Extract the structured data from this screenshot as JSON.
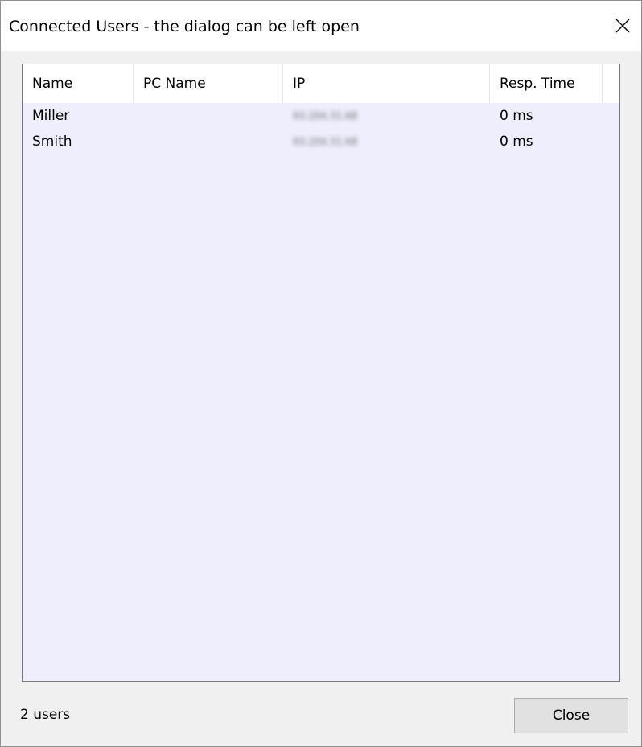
{
  "dialog": {
    "title": "Connected Users - the dialog can be left open",
    "close_icon": "close-icon"
  },
  "list": {
    "columns": [
      "Name",
      "PC Name",
      "IP",
      "Resp. Time"
    ],
    "rows": [
      {
        "name": "Miller",
        "pc_name": "",
        "ip": "93.204.31.68",
        "resp_time": "0 ms"
      },
      {
        "name": "Smith",
        "pc_name": "",
        "ip": "93.204.31.68",
        "resp_time": "0 ms"
      }
    ]
  },
  "footer": {
    "status": "2 users",
    "close_label": "Close"
  }
}
